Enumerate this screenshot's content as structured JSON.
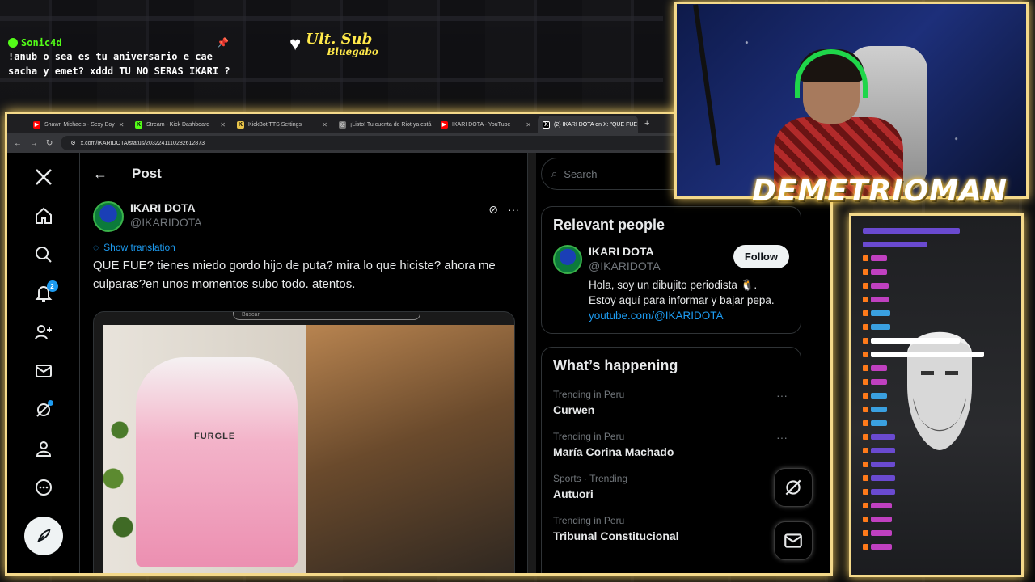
{
  "chat_overlay": {
    "username": "Sonic4d",
    "message_line1": "!anub o sea es tu aniversario e cae",
    "message_line2": "sacha y emet? xddd TU NO SERAS IKARI ?"
  },
  "ult_sub": {
    "title": "Ult. Sub",
    "name": "Bluegabo"
  },
  "browser": {
    "tabs": [
      {
        "label": "Shawn Michaels - Sexy Boy",
        "icon_color": "#ff0000",
        "icon": "youtube-icon"
      },
      {
        "label": "Stream - Kick Dashboard",
        "icon_color": "#53fc18",
        "icon": "kick-icon"
      },
      {
        "label": "KickBot TTS Settings",
        "icon_color": "#e8c44a",
        "icon": "kickbot-icon"
      },
      {
        "label": "¡Listo! Tu cuenta de Riot ya está",
        "icon_color": "#888888",
        "icon": "globe-icon"
      },
      {
        "label": "IKARI DOTA - YouTube",
        "icon_color": "#ff0000",
        "icon": "youtube-icon"
      },
      {
        "label": "(2) IKARI DOTA on X: \"QUE FUE",
        "icon_color": "#ffffff",
        "icon": "x-icon"
      }
    ],
    "url": "x.com/IKARIDOTA/status/2032241110282612873"
  },
  "nav": {
    "notifications_count": "2"
  },
  "post": {
    "header_title": "Post",
    "author_name": "IKARI DOTA",
    "author_handle": "@IKARIDOTA",
    "translate_label": "Show translation",
    "text": "QUE FUE?  tienes miedo gordo hijo de puta? mira lo que hiciste? ahora me culparas?en unos momentos subo todo. atentos.",
    "media_search_placeholder": "Buscar",
    "chair_brand": "FURGLE"
  },
  "sidebar": {
    "search_placeholder": "Search",
    "relevant_title": "Relevant people",
    "person_name": "IKARI DOTA",
    "person_handle": "@IKARIDOTA",
    "follow_label": "Follow",
    "bio_line1": "Hola, soy un dibujito periodista 🐧.",
    "bio_line2": "Estoy aquí para informar y bajar pepa.",
    "bio_link": "youtube.com/@IKARIDOTA",
    "happening_title": "What’s happening",
    "trends": [
      {
        "meta": "Trending in Peru",
        "name": "Curwen"
      },
      {
        "meta": "Trending in Peru",
        "name": "María Corina Machado"
      },
      {
        "meta": "Sports · Trending",
        "name": "Autuori"
      },
      {
        "meta": "Trending in Peru",
        "name": "Tribunal Constitucional"
      }
    ]
  },
  "streamer": {
    "name": "DEMETRIOMAN"
  },
  "colors": {
    "frame_gold": "#f4d98a",
    "x_blue": "#1d9bf0",
    "kick_green": "#53fc18"
  }
}
